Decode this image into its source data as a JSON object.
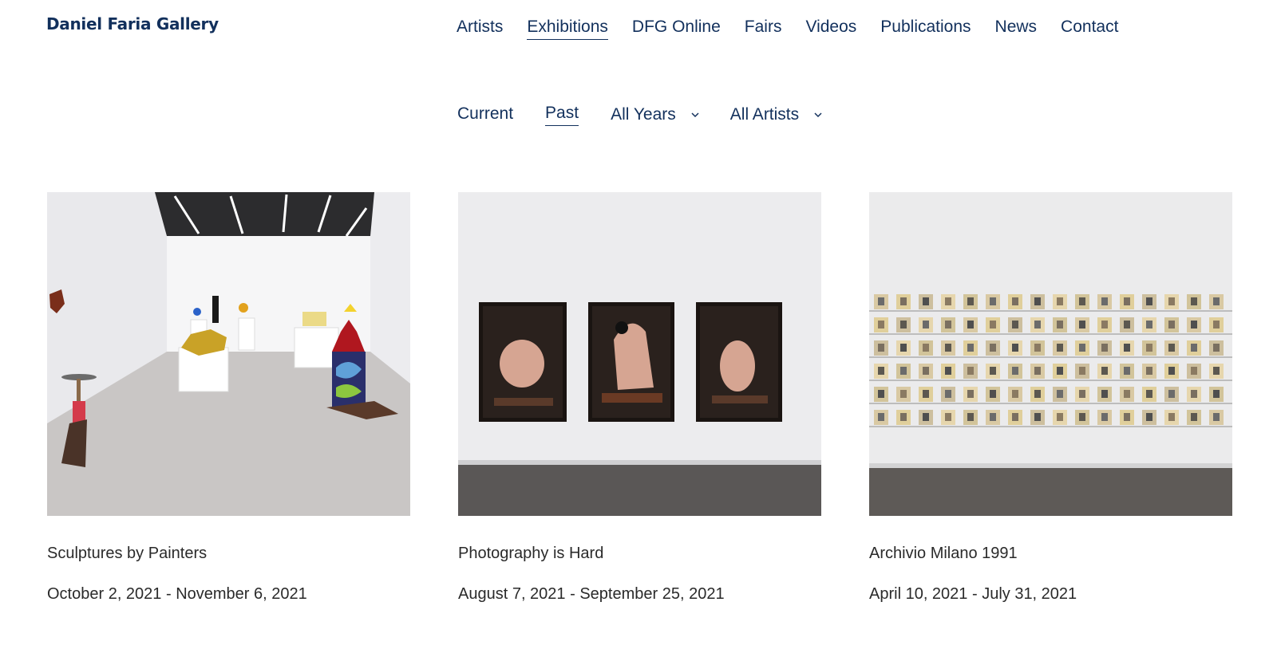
{
  "header": {
    "logo": "Daniel Faria Gallery",
    "nav": [
      {
        "label": "Artists"
      },
      {
        "label": "Exhibitions",
        "active": true
      },
      {
        "label": "DFG Online"
      },
      {
        "label": "Fairs"
      },
      {
        "label": "Videos"
      },
      {
        "label": "Publications"
      },
      {
        "label": "News"
      },
      {
        "label": "Contact"
      }
    ]
  },
  "filters": {
    "current": "Current",
    "past": "Past",
    "years": "All Years",
    "artists": "All Artists",
    "active": "Past"
  },
  "exhibitions": [
    {
      "title": "Sculptures by Painters",
      "dates": "October 2, 2021 - November 6, 2021"
    },
    {
      "title": "Photography is Hard",
      "dates": "August 7, 2021 - September 25, 2021"
    },
    {
      "title": "Archivio Milano 1991",
      "dates": "April 10, 2021 - July 31, 2021"
    }
  ],
  "colors": {
    "brand": "#12305c",
    "text": "#2a2a2a"
  },
  "icons": {
    "dropdown": "chevron-down-icon"
  }
}
